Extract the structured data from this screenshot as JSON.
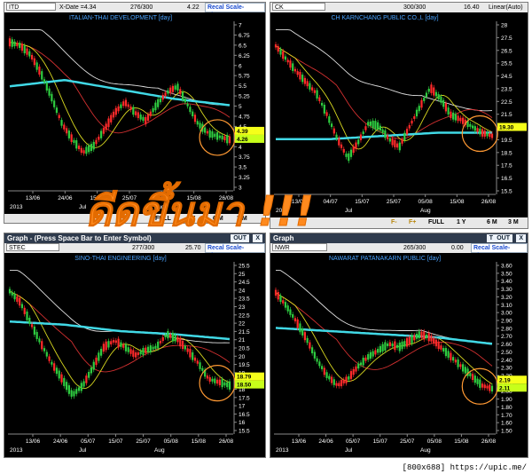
{
  "watermark": "[800x688] https://upic.me/",
  "handwriting": "ดีดขึ้นมา !!!",
  "colors": {
    "panel_bg": "#000000",
    "up": "#2ecc40",
    "down": "#ff2a2a",
    "ma_white": "#e0e0e0",
    "ma_red": "#d23030",
    "ma_yellow": "#d8d820",
    "ma_cyan": "#41d9e6",
    "circle": "#ff9933",
    "axis_text": "#ffffff",
    "scale_button": "#1a4bd0"
  },
  "panels": [
    {
      "symbol": "ITD",
      "info_left": "X-Date =4.34",
      "count": "276/300",
      "last": "4.22",
      "scale": "Recal Scale-Linear",
      "title": "ITALIAN-THAI DEVELOPMENT [day]",
      "yticks": [
        "7",
        "6.75",
        "6.5",
        "6.25",
        "6",
        "5.75",
        "5.5",
        "5.25",
        "5",
        "4.75",
        "4.5",
        "4.25",
        "4",
        "3.75",
        "3.5",
        "3.25",
        "3"
      ],
      "price_tags": [
        "4.39",
        "4.26"
      ],
      "xticks": [
        "13/06",
        "24/06",
        "15/07",
        "25/07",
        "05/08",
        "15/08",
        "26/08"
      ],
      "year": "2013",
      "months": [
        "Jul",
        "Aug"
      ],
      "bottom_buttons": [
        "FULL",
        "1 Y",
        "6 M",
        "3 M"
      ]
    },
    {
      "symbol": "CK",
      "info_left": "",
      "count": "300/300",
      "last": "16.40",
      "scale": "Linear(Auto)",
      "title": "CH KARNCHANG PUBLIC CO.,L [day]",
      "yticks": [
        "28",
        "27.5",
        "26.5",
        "25.5",
        "24.5",
        "23.5",
        "22.5",
        "21.5",
        "20.5",
        "19.5",
        "18.5",
        "17.5",
        "16.5",
        "15.5"
      ],
      "price_tags": [
        "19.30"
      ],
      "xticks": [
        "13/06",
        "04/07",
        "15/07",
        "25/07",
        "05/08",
        "15/08",
        "26/08"
      ],
      "year": "2013",
      "months": [
        "Jul",
        "Aug"
      ],
      "bottom_buttons": [
        "F-",
        "F+",
        "FULL",
        "1 Y",
        "6 M",
        "3 M"
      ]
    },
    {
      "graph_title": "Graph - (Press Space Bar to Enter Symbol)",
      "graph_buttons": [
        "OUT",
        "X"
      ],
      "symbol": "STEC",
      "info_left": "",
      "count": "277/300",
      "last": "25.70",
      "scale": "Recal Scale-Linear",
      "title": "SINO-THAI ENGINEERING [day]",
      "yticks": [
        "25.5",
        "25",
        "24.5",
        "24",
        "23.5",
        "23",
        "22.5",
        "22",
        "21.5",
        "21",
        "20.5",
        "20",
        "19.5",
        "19",
        "18.5",
        "18",
        "17.5",
        "17",
        "16.5",
        "16",
        "15.5"
      ],
      "price_tags": [
        "18.79",
        "18.50"
      ],
      "xticks": [
        "13/06",
        "24/06",
        "05/07",
        "15/07",
        "25/07",
        "05/08",
        "15/08",
        "26/08"
      ],
      "year": "2013",
      "months": [
        "Jul",
        "Aug"
      ],
      "bottom_buttons": []
    },
    {
      "graph_title": "Graph",
      "graph_buttons": [
        "T",
        "OUT",
        "X"
      ],
      "symbol": "NWR",
      "info_left": "",
      "count": "265/300",
      "last": "0.00",
      "scale": "Recal Scale-Linear",
      "title": "NAWARAT PATANAKARN PUBLIC [day]",
      "yticks": [
        "3.60",
        "3.50",
        "3.40",
        "3.30",
        "3.20",
        "3.10",
        "3.00",
        "2.90",
        "2.80",
        "2.70",
        "2.60",
        "2.50",
        "2.40",
        "2.30",
        "2.20",
        "2.10",
        "2.00",
        "1.90",
        "1.80",
        "1.70",
        "1.60",
        "1.50"
      ],
      "price_tags": [
        "2.19",
        "2.11"
      ],
      "xticks": [
        "13/06",
        "24/06",
        "05/07",
        "15/07",
        "25/07",
        "05/08",
        "15/08",
        "26/08"
      ],
      "year": "2013",
      "months": [
        "Jul",
        "Aug"
      ],
      "bottom_buttons": []
    }
  ]
}
